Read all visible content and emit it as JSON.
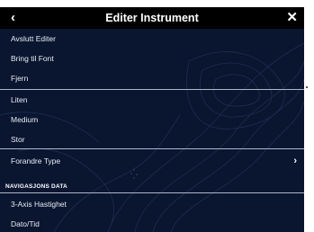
{
  "header": {
    "back_icon": "‹",
    "title": "Editer Instrument",
    "close_icon": "✕"
  },
  "menu": {
    "items": [
      {
        "label": "Avslutt Editer"
      },
      {
        "label": "Bring til Font"
      },
      {
        "label": "Fjern"
      },
      {
        "label": "Liten"
      },
      {
        "label": "Medium"
      },
      {
        "label": "Stor"
      },
      {
        "label": "Forandre Type",
        "chevron": "›"
      }
    ],
    "section_title": "NAVIGASJONS DATA",
    "data_items": [
      {
        "label": "3-Axis Hastighet"
      },
      {
        "label": "Dato/Tid"
      }
    ]
  },
  "colors": {
    "panel_bg": "#0a1530",
    "header_bg": "#000000",
    "separator": "#aeb6c8",
    "text": "#e8ecf4"
  }
}
